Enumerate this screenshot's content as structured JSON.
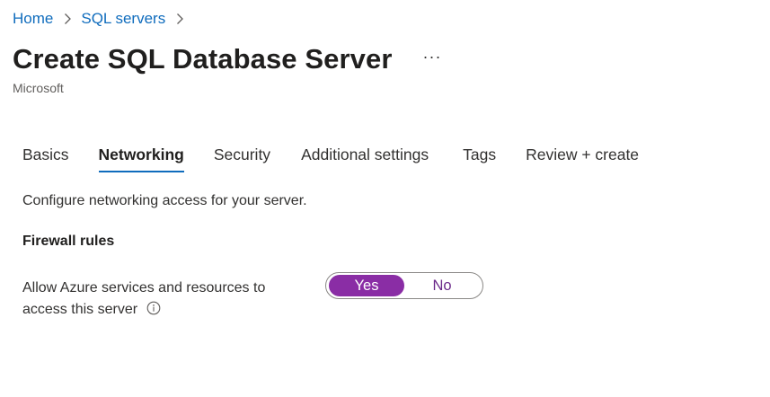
{
  "breadcrumb": {
    "items": [
      {
        "label": "Home"
      },
      {
        "label": "SQL servers"
      }
    ]
  },
  "header": {
    "title": "Create SQL Database Server",
    "more_label": "···",
    "subtitle": "Microsoft"
  },
  "tabs": [
    {
      "label": "Basics",
      "active": false
    },
    {
      "label": "Networking",
      "active": true
    },
    {
      "label": "Security",
      "active": false
    },
    {
      "label": "Additional settings",
      "active": false
    },
    {
      "label": "Tags",
      "active": false
    },
    {
      "label": "Review + create",
      "active": false
    }
  ],
  "main": {
    "description": "Configure networking access for your server.",
    "firewall": {
      "heading": "Firewall rules",
      "allow_azure": {
        "label_line1": "Allow Azure services and resources to",
        "label_line2": "access this server",
        "info_icon": "info-icon",
        "options": [
          "Yes",
          "No"
        ],
        "selected": "Yes"
      }
    }
  },
  "colors": {
    "link": "#0f6cbd",
    "tab_underline": "#0f6cbd",
    "toggle_selected": "#8a2da5",
    "toggle_unselected_text": "#6b2a8a"
  }
}
